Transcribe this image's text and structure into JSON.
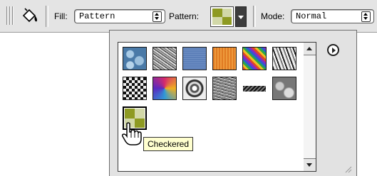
{
  "toolbar": {
    "tool_icon": "paint-bucket-icon",
    "fill_label": "Fill:",
    "fill_value": "Pattern",
    "pattern_label": "Pattern:",
    "pattern_dropdown_icon": "triangle-down-icon",
    "mode_label": "Mode:",
    "mode_value": "Normal"
  },
  "pattern_picker": {
    "menu_icon": "right-arrow-circle-icon",
    "selected_tooltip": "Checkered",
    "patterns": [
      {
        "name": "bubbles",
        "icon": "pattern-bubbles"
      },
      {
        "name": "wrinkles",
        "icon": "pattern-wrinkles"
      },
      {
        "name": "blue-fabric",
        "icon": "pattern-blue"
      },
      {
        "name": "orange-weave",
        "icon": "pattern-orange"
      },
      {
        "name": "rainbow",
        "icon": "pattern-rainbow"
      },
      {
        "name": "stone",
        "icon": "pattern-stone"
      },
      {
        "name": "checkerboard",
        "icon": "pattern-checkerboard"
      },
      {
        "name": "tie-dye",
        "icon": "pattern-tiedye"
      },
      {
        "name": "swirl",
        "icon": "pattern-swirl"
      },
      {
        "name": "noise",
        "icon": "pattern-noise"
      },
      {
        "name": "stripe",
        "icon": "pattern-stripe"
      },
      {
        "name": "clouds",
        "icon": "pattern-clouds"
      },
      {
        "name": "checkered",
        "icon": "pattern-checkered"
      }
    ]
  },
  "colors": {
    "checker_dark": "#8e9a22",
    "checker_light": "#d2d8a8",
    "tooltip_bg": "#ffffcf"
  }
}
